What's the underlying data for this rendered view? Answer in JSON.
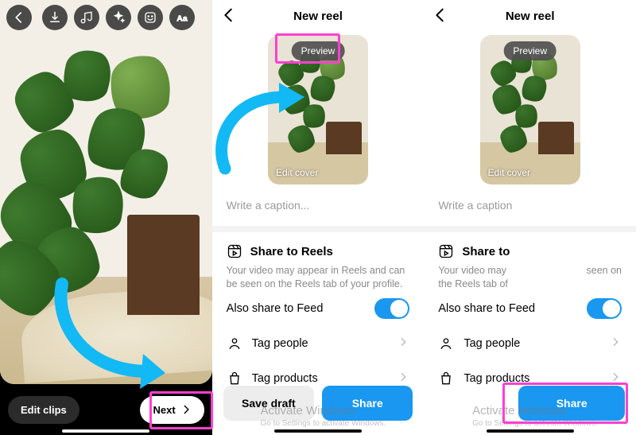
{
  "screen1": {
    "edit_clips": "Edit clips",
    "next": "Next"
  },
  "screen2": {
    "title": "New reel",
    "preview": "Preview",
    "edit_cover": "Edit cover",
    "caption_placeholder": "Write a caption...",
    "share_section_title": "Share to Reels",
    "share_section_sub": "Your video may appear in Reels and can be seen on the Reels tab of your profile.",
    "also_share": "Also share to Feed",
    "tag_people": "Tag people",
    "tag_products": "Tag products",
    "save_draft": "Save draft",
    "share": "Share"
  },
  "screen3": {
    "title": "New reel",
    "preview": "Preview",
    "edit_cover": "Edit cover",
    "caption_placeholder": "Write a caption",
    "share_section_title": "Share to",
    "share_section_sub_left": "Your video may",
    "share_section_sub_right": "seen on",
    "share_section_sub2": "the Reels tab of",
    "also_share": "Also share to Feed",
    "tag_people": "Tag people",
    "tag_products": "Tag products",
    "share": "Share"
  },
  "watermark": {
    "line1": "Activate Windows",
    "line2": "Go to Settings to activate Windows."
  }
}
